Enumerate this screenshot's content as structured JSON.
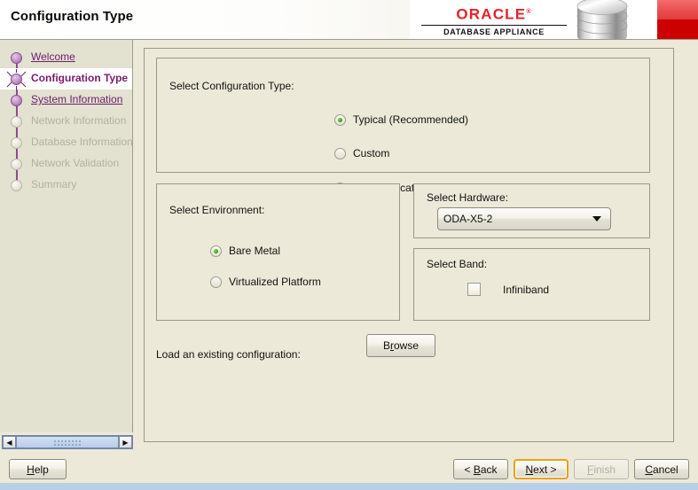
{
  "window": {
    "title": "Configuration Type"
  },
  "brand": {
    "oracle": "ORACLE",
    "trademark": "®",
    "product": "DATABASE APPLIANCE",
    "logo_icon": "database-stack-icon",
    "accent_red": "#e8202a",
    "panel_red_light": "#ee5a5a",
    "panel_red_dark": "#cc0000"
  },
  "sidebar": {
    "items": [
      {
        "label": "Welcome",
        "state": "visited"
      },
      {
        "label": "Configuration Type",
        "state": "current"
      },
      {
        "label": "System Information",
        "state": "visited"
      },
      {
        "label": "Network Information",
        "state": "disabled"
      },
      {
        "label": "Database Information",
        "state": "disabled"
      },
      {
        "label": "Network Validation",
        "state": "disabled"
      },
      {
        "label": "Summary",
        "state": "disabled"
      }
    ],
    "link_color": "#6b1e6b",
    "current_color": "#7d1a6e",
    "disabled_color": "#b2b0a1",
    "scrollbar": {
      "left_arrow": "◀",
      "right_arrow": "▶"
    }
  },
  "main": {
    "config_group": {
      "title": "Select Configuration Type:",
      "options": [
        {
          "label": "Typical (Recommended)",
          "selected": true
        },
        {
          "label": "Custom",
          "selected": false
        },
        {
          "label": "SAP Application",
          "selected": false
        }
      ]
    },
    "environment_group": {
      "title": "Select Environment:",
      "options": [
        {
          "label": "Bare Metal",
          "selected": true
        },
        {
          "label": "Virtualized Platform",
          "selected": false
        }
      ]
    },
    "hardware_group": {
      "title": "Select Hardware:",
      "selected": "ODA-X5-2",
      "options": [
        "ODA-X5-2"
      ]
    },
    "band_group": {
      "title": "Select Band:",
      "checkbox_label": "Infiniband",
      "checked": false
    },
    "load_config": {
      "label": "Load an existing configuration:",
      "browse_before": "B",
      "browse_mnemonic": "r",
      "browse_after": "owse"
    }
  },
  "footer": {
    "help": {
      "before": "",
      "mnemonic": "H",
      "after": "elp",
      "enabled": true
    },
    "back": {
      "before": "< ",
      "mnemonic": "B",
      "after": "ack",
      "enabled": true
    },
    "next": {
      "before": "",
      "mnemonic": "N",
      "after": "ext >",
      "enabled": true,
      "focused": true
    },
    "finish": {
      "before": "",
      "mnemonic": "F",
      "after": "inish",
      "enabled": false
    },
    "cancel": {
      "before": "",
      "mnemonic": "C",
      "after": "ancel",
      "enabled": true
    }
  },
  "colors": {
    "window_bg": "#ece9d8",
    "sidebar_bg": "#e3e1d0",
    "border": "#9a9886",
    "focus_ring": "#e7a21b",
    "radio_on": "#2ea012",
    "desktop": "#b8cfe8"
  }
}
